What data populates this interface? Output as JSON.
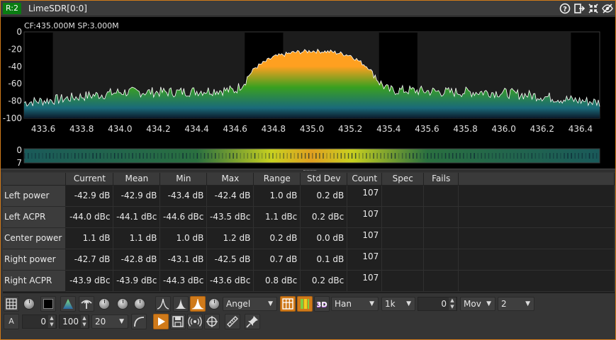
{
  "window": {
    "rx_badge": "R:2",
    "title": "LimeSDR[0:0]",
    "icons": [
      "help-icon",
      "move-to-workspace-icon",
      "shrink-icon",
      "close-icon",
      "hide-icon"
    ]
  },
  "spectrum": {
    "readout": "CF:435.000M SP:3.000M",
    "colors": {
      "trace": "#ffffff",
      "fill_top": "#ffa020",
      "fill_mid": "#3aa020",
      "fill_low": "#1a6a7a",
      "band_highlight": "#1c1c1c"
    }
  },
  "chart_data": [
    {
      "type": "area",
      "ylim": [
        -100,
        0
      ],
      "xlim": [
        433.5,
        436.5
      ],
      "y_ticks": [
        "0",
        "-20",
        "-40",
        "-60",
        "-80",
        "-100"
      ],
      "x_ticks": [
        "433.6",
        "433.8",
        "434.0",
        "434.2",
        "434.4",
        "434.6",
        "434.8",
        "435.0",
        "435.2",
        "435.4",
        "435.6",
        "435.8",
        "436.0",
        "436.2",
        "436.4"
      ],
      "grid": false,
      "highlight_bands": [
        [
          433.65,
          434.65
        ],
        [
          434.85,
          435.35
        ],
        [
          435.55,
          436.35
        ]
      ],
      "series": [
        {
          "x": [
            433.5,
            433.6,
            433.7,
            433.8,
            433.9,
            434.0,
            434.1,
            434.2,
            434.3,
            434.4,
            434.5,
            434.6,
            434.65,
            434.7,
            434.8,
            434.9,
            435.0,
            435.1,
            435.2,
            435.3,
            435.35,
            435.4,
            435.5,
            435.6,
            435.7,
            435.8,
            435.9,
            436.0,
            436.1,
            436.2,
            436.3,
            436.4,
            436.5
          ],
          "y": [
            -84,
            -82,
            -80,
            -77,
            -75,
            -72,
            -72,
            -72,
            -72,
            -71,
            -70,
            -70,
            -60,
            -42,
            -29,
            -24,
            -22,
            -23,
            -27,
            -42,
            -60,
            -70,
            -70,
            -71,
            -72,
            -72,
            -72,
            -73,
            -75,
            -77,
            -80,
            -82,
            -84
          ]
        }
      ]
    },
    {
      "type": "heatmap",
      "y_ticks": [
        "0",
        "7"
      ]
    }
  ],
  "table": {
    "columns": [
      "Current",
      "Mean",
      "Min",
      "Max",
      "Range",
      "Std Dev",
      "Count",
      "Spec",
      "Fails"
    ],
    "rows": [
      {
        "label": "Left power",
        "values": [
          "-42.9 dB",
          "-42.9 dB",
          "-43.4 dB",
          "-42.4 dB",
          "1.0 dB",
          "0.2 dB",
          "107",
          "",
          ""
        ]
      },
      {
        "label": "Left ACPR",
        "values": [
          "-44.0 dBc",
          "-44.1 dBc",
          "-44.6 dBc",
          "-43.5 dBc",
          "1.1 dBc",
          "0.2 dBc",
          "107",
          "",
          ""
        ]
      },
      {
        "label": "Center power",
        "values": [
          "1.1 dB",
          "1.1 dB",
          "1.0 dB",
          "1.2 dB",
          "0.2 dB",
          "0.0 dB",
          "107",
          "",
          ""
        ]
      },
      {
        "label": "Right power",
        "values": [
          "-42.7 dB",
          "-42.8 dB",
          "-43.1 dB",
          "-42.5 dB",
          "0.7 dB",
          "0.1 dB",
          "107",
          "",
          ""
        ]
      },
      {
        "label": "Right ACPR",
        "values": [
          "-43.9 dBc",
          "-43.9 dBc",
          "-44.3 dBc",
          "-43.6 dBc",
          "0.8 dBc",
          "0.2 dBc",
          "107",
          "",
          ""
        ]
      }
    ]
  },
  "controls": {
    "palette": "Angel",
    "window_fn": "Han",
    "fft_size": "1k",
    "overlap": "0",
    "averaging_mode": "Mov",
    "averaging_value": "2",
    "ref_level": "0",
    "range": "100",
    "fps": "20",
    "auto_label": "A",
    "label_3d": "3D"
  }
}
